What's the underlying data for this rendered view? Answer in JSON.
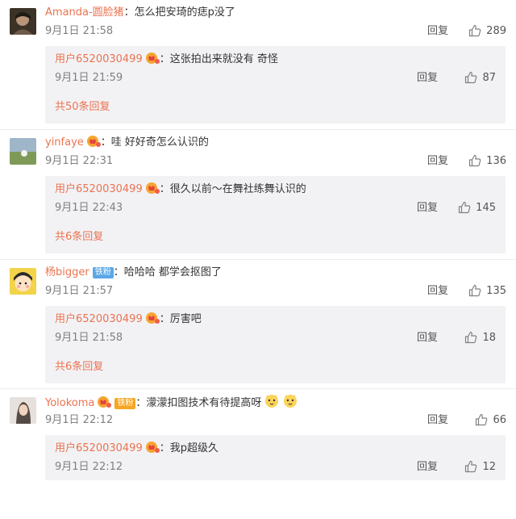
{
  "ui": {
    "reply_label": "回复"
  },
  "comments": [
    {
      "user": "Amanda-圆脸猪",
      "text": "：怎么把安琦的痣p没了",
      "time": "9月1日 21:58",
      "likes": "289",
      "reply": {
        "user": "用户6520030499",
        "text": "：这张拍出来就没有 奇怪",
        "time": "9月1日 21:59",
        "likes": "87"
      },
      "more": "共50条回复"
    },
    {
      "user": "yinfaye",
      "text": "：哇 好好奇怎么认识的",
      "time": "9月1日 22:31",
      "likes": "136",
      "reply": {
        "user": "用户6520030499",
        "text": "：很久以前～在舞社练舞认识的",
        "time": "9月1日 22:43",
        "likes": "145"
      },
      "more": "共6条回复"
    },
    {
      "user": "杨bigger",
      "tag": "铁粉",
      "text": "：哈哈哈 都学会抠图了",
      "time": "9月1日 21:57",
      "likes": "135",
      "reply": {
        "user": "用户6520030499",
        "text": "：厉害吧",
        "time": "9月1日 21:58",
        "likes": "18"
      },
      "more": "共6条回复"
    },
    {
      "user": "Yolokoma",
      "tag": "铁粉",
      "text": "：濛濛扣图技术有待提高呀",
      "time": "9月1日 22:12",
      "likes": "66",
      "reply": {
        "user": "用户6520030499",
        "text": "：我p超级久",
        "time": "9月1日 22:12",
        "likes": "12"
      }
    }
  ]
}
